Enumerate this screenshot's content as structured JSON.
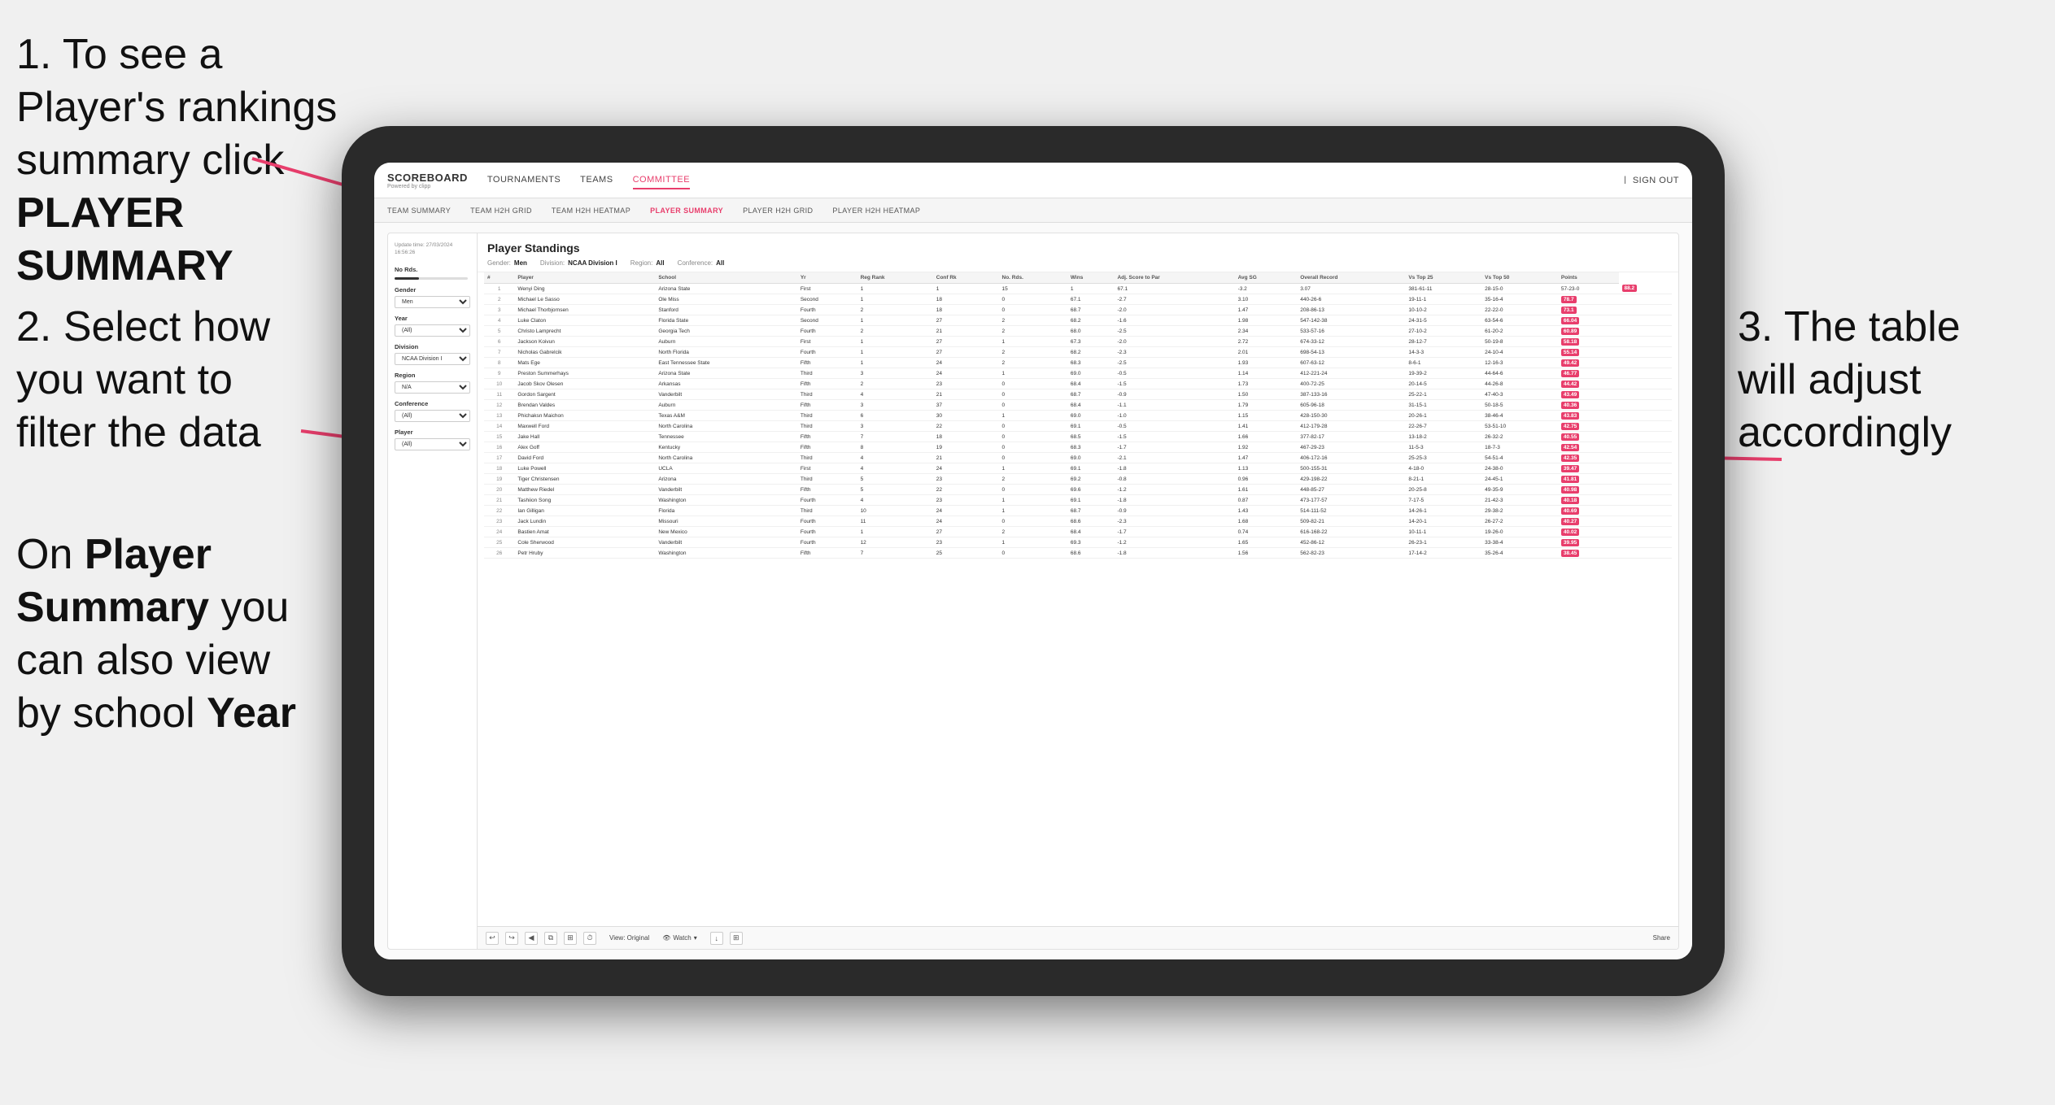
{
  "annotations": {
    "step1": {
      "number": "1.",
      "text1": "To see a Player's rankings",
      "text2": "summary click ",
      "bold": "PLAYER SUMMARY"
    },
    "step2": {
      "text": "2. Select how you want to filter the data"
    },
    "step3_bottom": {
      "text1": "On ",
      "bold1": "Player Summary",
      "text2": " you can also view by school ",
      "bold2": "Year"
    },
    "step3_right": {
      "text": "3. The table will adjust accordingly"
    }
  },
  "app": {
    "logo": "SCOREBOARD",
    "logo_sub": "Powered by clipp",
    "nav": [
      "TOURNAMENTS",
      "TEAMS",
      "COMMITTEE"
    ],
    "sign_out": "Sign out",
    "sub_nav": [
      "TEAM SUMMARY",
      "TEAM H2H GRID",
      "TEAM H2H HEATMAP",
      "PLAYER SUMMARY",
      "PLAYER H2H GRID",
      "PLAYER H2H HEATMAP"
    ]
  },
  "filters": {
    "update_time": "Update time:\n27/03/2024 16:56:26",
    "no_rds_label": "No Rds.",
    "gender_label": "Gender",
    "gender_value": "Men",
    "year_label": "Year",
    "year_value": "(All)",
    "division_label": "Division",
    "division_value": "NCAA Division I",
    "region_label": "Region",
    "region_value": "N/A",
    "conference_label": "Conference",
    "conference_value": "(All)",
    "player_label": "Player",
    "player_value": "(All)"
  },
  "table": {
    "title": "Player Standings",
    "gender_label": "Gender:",
    "gender_val": "Men",
    "division_label": "Division:",
    "division_val": "NCAA Division I",
    "region_label": "Region:",
    "region_val": "All",
    "conference_label": "Conference:",
    "conference_val": "All",
    "columns": [
      "#",
      "Player",
      "School",
      "Yr",
      "Reg Rank",
      "Conf Rk",
      "No. Rds.",
      "Wins",
      "Adj. Score to Par",
      "Avg SG",
      "Overall Record",
      "Vs Top 25",
      "Vs Top 50",
      "Points"
    ],
    "rows": [
      [
        "1",
        "Wenyi Ding",
        "Arizona State",
        "First",
        "1",
        "1",
        "15",
        "1",
        "67.1",
        "-3.2",
        "3.07",
        "381-61-11",
        "28-15-0",
        "57-23-0",
        "88.2"
      ],
      [
        "2",
        "Michael Le Sasso",
        "Ole Miss",
        "Second",
        "1",
        "18",
        "0",
        "67.1",
        "-2.7",
        "3.10",
        "440-26-6",
        "19-11-1",
        "35-16-4",
        "78.7"
      ],
      [
        "3",
        "Michael Thorbjornsen",
        "Stanford",
        "Fourth",
        "2",
        "18",
        "0",
        "68.7",
        "-2.0",
        "1.47",
        "208-86-13",
        "10-10-2",
        "22-22-0",
        "73.1"
      ],
      [
        "4",
        "Luke Claton",
        "Florida State",
        "Second",
        "1",
        "27",
        "2",
        "68.2",
        "-1.6",
        "1.98",
        "547-142-38",
        "24-31-5",
        "63-54-6",
        "66.04"
      ],
      [
        "5",
        "Christo Lamprecht",
        "Georgia Tech",
        "Fourth",
        "2",
        "21",
        "2",
        "68.0",
        "-2.5",
        "2.34",
        "533-57-16",
        "27-10-2",
        "61-20-2",
        "60.89"
      ],
      [
        "6",
        "Jackson Koivun",
        "Auburn",
        "First",
        "1",
        "27",
        "1",
        "67.3",
        "-2.0",
        "2.72",
        "674-33-12",
        "28-12-7",
        "50-19-8",
        "58.18"
      ],
      [
        "7",
        "Nicholas Gabrelcik",
        "North Florida",
        "Fourth",
        "1",
        "27",
        "2",
        "68.2",
        "-2.3",
        "2.01",
        "698-54-13",
        "14-3-3",
        "24-10-4",
        "55.14"
      ],
      [
        "8",
        "Mats Ege",
        "East Tennessee State",
        "Fifth",
        "1",
        "24",
        "2",
        "68.3",
        "-2.5",
        "1.93",
        "607-63-12",
        "8-6-1",
        "12-16-3",
        "49.42"
      ],
      [
        "9",
        "Preston Summerhays",
        "Arizona State",
        "Third",
        "3",
        "24",
        "1",
        "69.0",
        "-0.5",
        "1.14",
        "412-221-24",
        "19-39-2",
        "44-64-6",
        "46.77"
      ],
      [
        "10",
        "Jacob Skov Olesen",
        "Arkansas",
        "Fifth",
        "2",
        "23",
        "0",
        "68.4",
        "-1.5",
        "1.73",
        "400-72-25",
        "20-14-5",
        "44-26-8",
        "44.42"
      ],
      [
        "11",
        "Gordon Sargent",
        "Vanderbilt",
        "Third",
        "4",
        "21",
        "0",
        "68.7",
        "-0.9",
        "1.50",
        "387-133-16",
        "25-22-1",
        "47-40-3",
        "43.49"
      ],
      [
        "12",
        "Brendan Valdes",
        "Auburn",
        "Fifth",
        "3",
        "37",
        "0",
        "68.4",
        "-1.1",
        "1.79",
        "605-96-18",
        "31-15-1",
        "50-18-5",
        "40.36"
      ],
      [
        "13",
        "Phichaksn Maichon",
        "Texas A&M",
        "Third",
        "6",
        "30",
        "1",
        "69.0",
        "-1.0",
        "1.15",
        "428-150-30",
        "20-26-1",
        "38-46-4",
        "43.83"
      ],
      [
        "14",
        "Maxwell Ford",
        "North Carolina",
        "Third",
        "3",
        "22",
        "0",
        "69.1",
        "-0.5",
        "1.41",
        "412-179-28",
        "22-26-7",
        "53-51-10",
        "42.75"
      ],
      [
        "15",
        "Jake Hall",
        "Tennessee",
        "Fifth",
        "7",
        "18",
        "0",
        "68.5",
        "-1.5",
        "1.66",
        "377-82-17",
        "13-18-2",
        "26-32-2",
        "40.55"
      ],
      [
        "16",
        "Alex Goff",
        "Kentucky",
        "Fifth",
        "8",
        "19",
        "0",
        "68.3",
        "-1.7",
        "1.92",
        "467-29-23",
        "11-5-3",
        "18-7-3",
        "42.54"
      ],
      [
        "17",
        "David Ford",
        "North Carolina",
        "Third",
        "4",
        "21",
        "0",
        "69.0",
        "-2.1",
        "1.47",
        "406-172-16",
        "25-25-3",
        "54-51-4",
        "42.35"
      ],
      [
        "18",
        "Luke Powell",
        "UCLA",
        "First",
        "4",
        "24",
        "1",
        "69.1",
        "-1.8",
        "1.13",
        "500-155-31",
        "4-18-0",
        "24-38-0",
        "39.47"
      ],
      [
        "19",
        "Tiger Christensen",
        "Arizona",
        "Third",
        "5",
        "23",
        "2",
        "69.2",
        "-0.8",
        "0.96",
        "429-198-22",
        "8-21-1",
        "24-45-1",
        "41.81"
      ],
      [
        "20",
        "Matthew Riedel",
        "Vanderbilt",
        "Fifth",
        "5",
        "22",
        "0",
        "69.6",
        "-1.2",
        "1.61",
        "448-85-27",
        "20-25-8",
        "49-35-9",
        "40.98"
      ],
      [
        "21",
        "Tashiion Song",
        "Washington",
        "Fourth",
        "4",
        "23",
        "1",
        "69.1",
        "-1.8",
        "0.87",
        "473-177-57",
        "7-17-5",
        "21-42-3",
        "40.18"
      ],
      [
        "22",
        "Ian Gilligan",
        "Florida",
        "Third",
        "10",
        "24",
        "1",
        "68.7",
        "-0.9",
        "1.43",
        "514-111-52",
        "14-26-1",
        "29-38-2",
        "40.69"
      ],
      [
        "23",
        "Jack Lundin",
        "Missouri",
        "Fourth",
        "11",
        "24",
        "0",
        "68.6",
        "-2.3",
        "1.68",
        "509-82-21",
        "14-20-1",
        "26-27-2",
        "40.27"
      ],
      [
        "24",
        "Bastien Amat",
        "New Mexico",
        "Fourth",
        "1",
        "27",
        "2",
        "68.4",
        "-1.7",
        "0.74",
        "616-168-22",
        "10-11-1",
        "19-26-0",
        "40.02"
      ],
      [
        "25",
        "Cole Sherwood",
        "Vanderbilt",
        "Fourth",
        "12",
        "23",
        "1",
        "69.3",
        "-1.2",
        "1.65",
        "452-86-12",
        "26-23-1",
        "33-38-4",
        "39.95"
      ],
      [
        "26",
        "Petr Hruby",
        "Washington",
        "Fifth",
        "7",
        "25",
        "0",
        "68.6",
        "-1.8",
        "1.56",
        "562-82-23",
        "17-14-2",
        "35-26-4",
        "38.45"
      ]
    ]
  },
  "toolbar": {
    "view_label": "View: Original",
    "watch_label": "Watch",
    "share_label": "Share"
  }
}
